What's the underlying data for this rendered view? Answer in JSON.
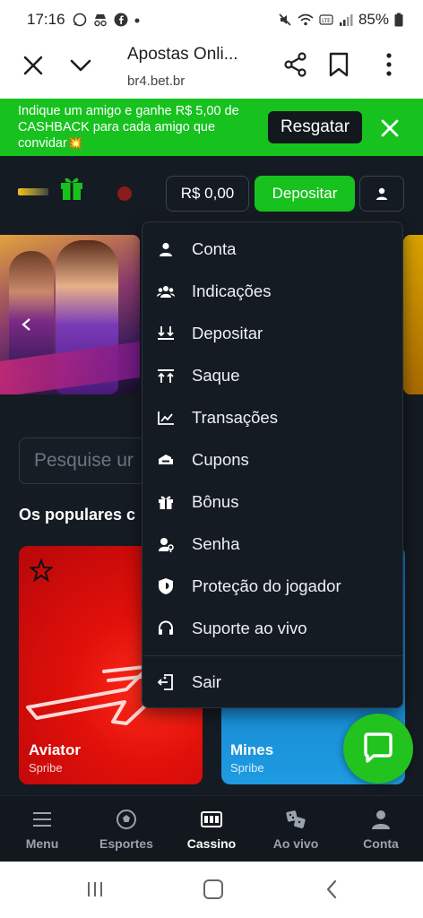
{
  "status_bar": {
    "time": "17:16",
    "battery": "85%",
    "left_icons": [
      "whatsapp-icon",
      "incognito-icon",
      "facebook-icon",
      "dot-icon"
    ],
    "right_icons": [
      "mute-icon",
      "wifi-icon",
      "volte-icon",
      "signal-icon",
      "battery-icon"
    ]
  },
  "browser": {
    "title": "Apostas Onli...",
    "url": "br4.bet.br"
  },
  "promo": {
    "text": "Indique um amigo e ganhe R$ 5,00 de CASHBACK para cada amigo que convidar💥",
    "button": "Resgatar"
  },
  "header": {
    "balance": "R$ 0,00",
    "deposit": "Depositar"
  },
  "main": {
    "search_placeholder": "Pesquise ur",
    "popular_title": "Os populares c",
    "games": [
      {
        "name": "Aviator",
        "provider": "Spribe"
      },
      {
        "name": "Mines",
        "provider": "Spribe"
      }
    ]
  },
  "account_menu": {
    "items": [
      {
        "label": "Conta",
        "icon": "user-icon"
      },
      {
        "label": "Indicações",
        "icon": "referrals-icon"
      },
      {
        "label": "Depositar",
        "icon": "deposit-icon"
      },
      {
        "label": "Saque",
        "icon": "withdraw-icon"
      },
      {
        "label": "Transações",
        "icon": "transactions-chart-icon"
      },
      {
        "label": "Cupons",
        "icon": "coupon-icon"
      },
      {
        "label": "Bônus",
        "icon": "gift-icon"
      },
      {
        "label": "Senha",
        "icon": "password-icon"
      },
      {
        "label": "Proteção do jogador",
        "icon": "shield-icon"
      },
      {
        "label": "Suporte ao vivo",
        "icon": "headset-icon"
      }
    ],
    "logout": {
      "label": "Sair",
      "icon": "logout-icon"
    }
  },
  "bottom_nav": {
    "items": [
      {
        "label": "Menu",
        "icon": "hamburger-icon"
      },
      {
        "label": "Esportes",
        "icon": "soccer-ball-icon"
      },
      {
        "label": "Cassino",
        "icon": "slot-machine-icon"
      },
      {
        "label": "Ao vivo",
        "icon": "dice-icon"
      },
      {
        "label": "Conta",
        "icon": "user-icon"
      }
    ],
    "active": "Cassino"
  },
  "colors": {
    "accent_green": "#18c21e",
    "background": "#151b22",
    "aviator_red": "#e0100a",
    "mines_blue": "#1e9be2"
  }
}
